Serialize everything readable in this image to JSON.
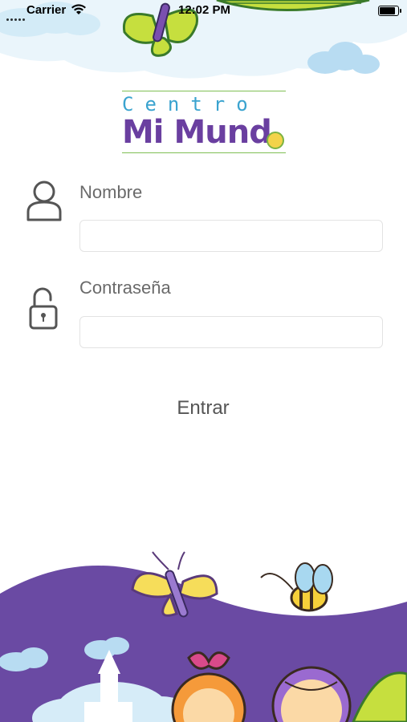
{
  "status_bar": {
    "carrier": "Carrier",
    "time": "12:02 PM",
    "battery_level": 0.9
  },
  "logo": {
    "line1": "Centro",
    "line2": "Mi Mund",
    "line2_last_letter": "o"
  },
  "form": {
    "name_label": "Nombre",
    "name_value": "",
    "password_label": "Contraseña",
    "password_value": "",
    "submit_label": "Entrar"
  },
  "icons": {
    "name": "user-icon",
    "password": "unlock-icon",
    "wifi": "wifi-icon",
    "battery": "battery-icon"
  },
  "colors": {
    "purple": "#6a3fa0",
    "blue_text": "#3aa3cf",
    "green_line": "#7fbf55",
    "label_gray": "#6a6a6a"
  }
}
